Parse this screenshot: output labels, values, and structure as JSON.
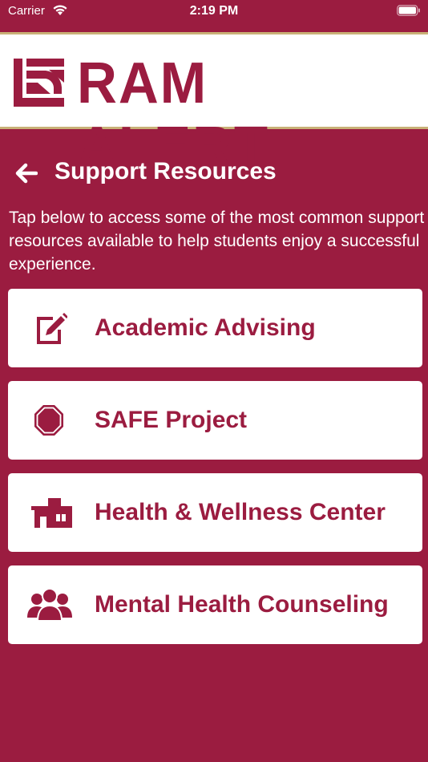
{
  "status_bar": {
    "carrier": "Carrier",
    "time": "2:19 PM"
  },
  "logo": {
    "text": "RAM ALERT"
  },
  "header": {
    "title": "Support Resources"
  },
  "intro": "Tap below to access some of the most common support resources available to help students enjoy a successful experience.",
  "resources": [
    {
      "label": "Academic Advising",
      "icon": "edit-square-icon"
    },
    {
      "label": "SAFE Project",
      "icon": "stop-octagon-icon"
    },
    {
      "label": "Health & Wellness Center",
      "icon": "clinic-building-icon"
    },
    {
      "label": "Mental Health Counseling",
      "icon": "people-group-icon"
    }
  ],
  "colors": {
    "brand": "#9b1c40",
    "gold": "#c9b177",
    "card": "#ffffff"
  }
}
